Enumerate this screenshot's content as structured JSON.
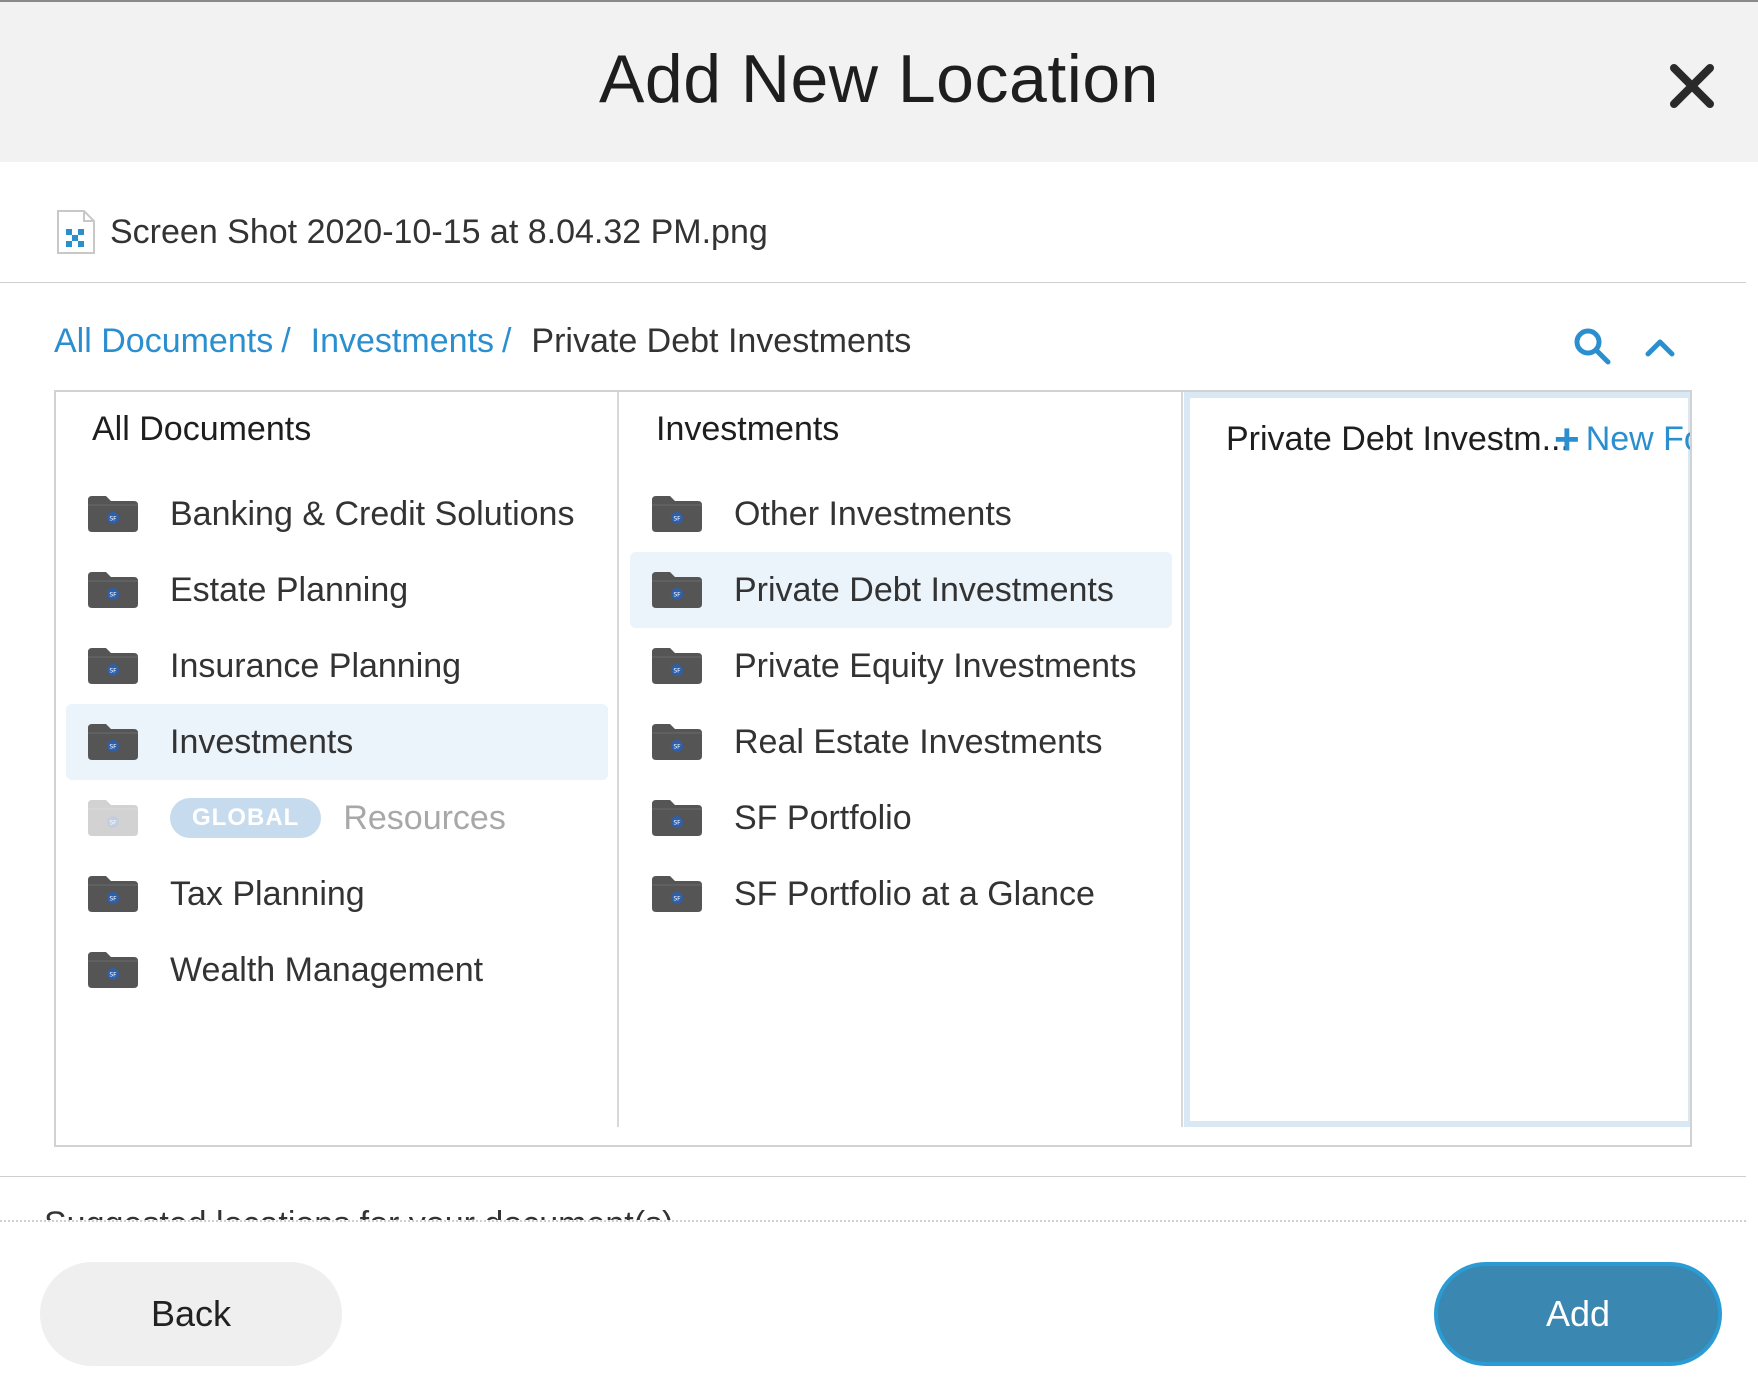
{
  "dialog": {
    "title": "Add New Location"
  },
  "file": {
    "name": "Screen Shot 2020-10-15 at 8.04.32 PM.png"
  },
  "breadcrumb": {
    "items": [
      "All Documents",
      "Investments"
    ],
    "separator": "/",
    "current": "Private Debt Investments"
  },
  "columns": {
    "col1": {
      "header": "All Documents",
      "items": [
        {
          "label": "Banking & Credit Solutions"
        },
        {
          "label": "Estate Planning"
        },
        {
          "label": "Insurance Planning"
        },
        {
          "label": "Investments",
          "selected": true
        },
        {
          "label": "Resources",
          "badge": "GLOBAL",
          "disabled": true
        },
        {
          "label": "Tax Planning"
        },
        {
          "label": "Wealth Management"
        }
      ]
    },
    "col2": {
      "header": "Investments",
      "items": [
        {
          "label": "Other Investments"
        },
        {
          "label": "Private Debt Investments",
          "selected": true
        },
        {
          "label": "Private Equity Investments"
        },
        {
          "label": "Real Estate Investments"
        },
        {
          "label": "SF Portfolio"
        },
        {
          "label": "SF Portfolio at a Glance"
        }
      ]
    },
    "col3": {
      "header": "Private Debt Investm...",
      "new_folder_label": "New Fo"
    }
  },
  "suggested": {
    "text": "Suggested locations for your document(s)"
  },
  "footer": {
    "back_label": "Back",
    "add_label": "Add"
  },
  "colors": {
    "accent": "#2b8fcf",
    "primary_button": "#3a87b1",
    "selected_row": "#ebf3fb",
    "folder": "#555555"
  }
}
